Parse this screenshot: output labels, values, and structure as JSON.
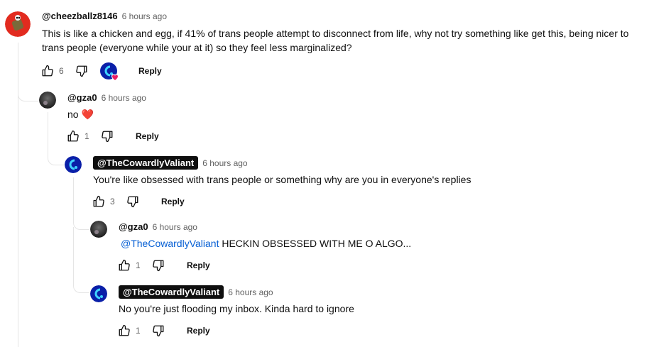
{
  "comments": [
    {
      "author": "@cheezballz8146",
      "time": "6 hours ago",
      "text": "This is like a chicken and egg, if 41% of trans people attempt to disconnect from life, why not try something like get this, being nicer to trans people (everyone while your at it) so they feel less marginalized?",
      "likes": "6",
      "reply_label": "Reply",
      "creator_heart": true
    },
    {
      "author": "@gza0",
      "time": "6 hours ago",
      "text": "no",
      "emoji": "❤️",
      "likes": "1",
      "reply_label": "Reply"
    },
    {
      "author": "@TheCowardlyValiant",
      "time": "6 hours ago",
      "text": "You're like obsessed with trans people or something why are you in everyone's replies",
      "likes": "3",
      "reply_label": "Reply"
    },
    {
      "author": "@gza0",
      "time": "6 hours ago",
      "mention": "@TheCowardlyValiant",
      "text": " HECKIN OBSESSED WITH ME O ALGO...",
      "likes": "1",
      "reply_label": "Reply"
    },
    {
      "author": "@TheCowardlyValiant",
      "time": "6 hours ago",
      "text": "No you're just flooding my inbox. Kinda hard to ignore",
      "likes": "1",
      "reply_label": "Reply"
    }
  ],
  "colors": {
    "mention": "#065fd4",
    "badge_bg": "#0f0f0f",
    "heart": "#e91e63"
  }
}
